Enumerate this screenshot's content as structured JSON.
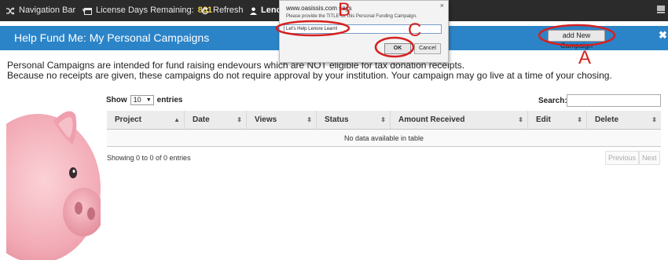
{
  "topnav": {
    "nav_label": "Navigation Bar",
    "license_label": "License Days Remaining:",
    "license_days": "861",
    "refresh_label": "Refresh",
    "user_label": "Lenore"
  },
  "header": {
    "title": "Help Fund Me: My Personal Campaigns",
    "add_button": "add New Campaign",
    "close_glyph": "✖"
  },
  "intro": {
    "line1": "Personal Campaigns are intended for fund raising endevours which are NOT eligible for tax donation receipts.",
    "line2": "Because no receipts are given, these campaigns do not require approval by your institution. Your campaign may go live at a time of your chosing."
  },
  "table_controls": {
    "show_label": "Show",
    "page_size": "10",
    "entries_label": "entries",
    "search_label": "Search:"
  },
  "table": {
    "columns": [
      "Project",
      "Date",
      "Views",
      "Status",
      "Amount Received",
      "Edit",
      "Delete"
    ],
    "empty_message": "No data available in table",
    "showing": "Showing 0 to 0 of 0 entries",
    "prev_label": "Previous",
    "next_label": "Next"
  },
  "dialog": {
    "title": "www.oasissis.com says",
    "prompt": "Please provide the TITLE for this Personal Funding Campaign.",
    "input_value": "Let's Help Lenore Learn!",
    "ok_label": "OK",
    "cancel_label": "Cancel",
    "close_glyph": "×"
  },
  "annotations": {
    "letters": [
      "A",
      "B",
      "C"
    ],
    "color": "#d62020"
  },
  "colors": {
    "nav_bg": "#2b2b2b",
    "header_bg": "#2c84c8",
    "license_accent": "#f2d13b",
    "pig_pink": "#f4b3bd"
  }
}
